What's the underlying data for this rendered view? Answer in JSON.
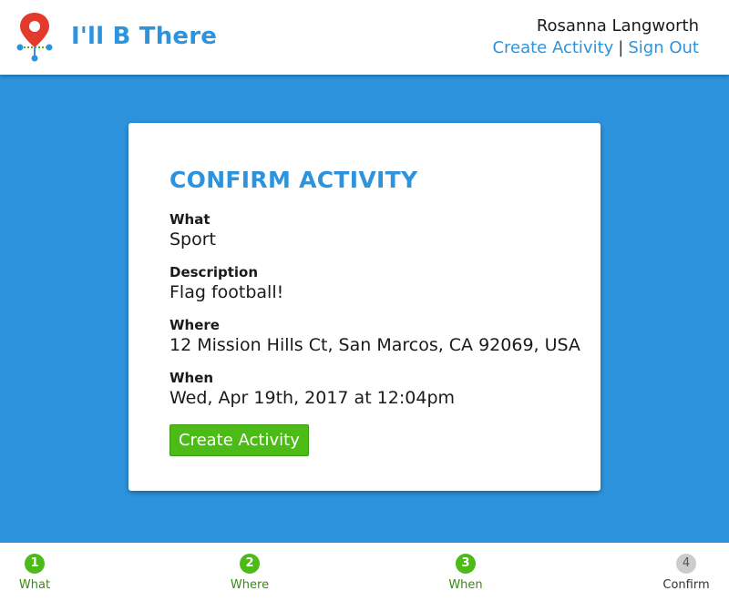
{
  "app": {
    "name": "I'll B There"
  },
  "header": {
    "user_name": "Rosanna Langworth",
    "links": {
      "create": "Create Activity",
      "separator": "|",
      "sign_out": "Sign Out"
    }
  },
  "card": {
    "title": "CONFIRM ACTIVITY",
    "fields": [
      {
        "label": "What",
        "value": "Sport"
      },
      {
        "label": "Description",
        "value": "Flag football!"
      },
      {
        "label": "Where",
        "value": "12 Mission Hills Ct, San Marcos, CA 92069, USA"
      },
      {
        "label": "When",
        "value": "Wed, Apr 19th, 2017 at 12:04pm"
      }
    ],
    "button_label": "Create Activity"
  },
  "steps": [
    {
      "number": "1",
      "label": "What",
      "state": "done"
    },
    {
      "number": "2",
      "label": "Where",
      "state": "done"
    },
    {
      "number": "3",
      "label": "When",
      "state": "done"
    },
    {
      "number": "4",
      "label": "Confirm",
      "state": "current"
    }
  ],
  "colors": {
    "brand_blue": "#2d93dd",
    "success_green": "#4cbb17",
    "pin_red": "#e23b2e",
    "inactive_gray": "#cccccc"
  },
  "icons": {
    "logo": "map-pin-icon"
  }
}
